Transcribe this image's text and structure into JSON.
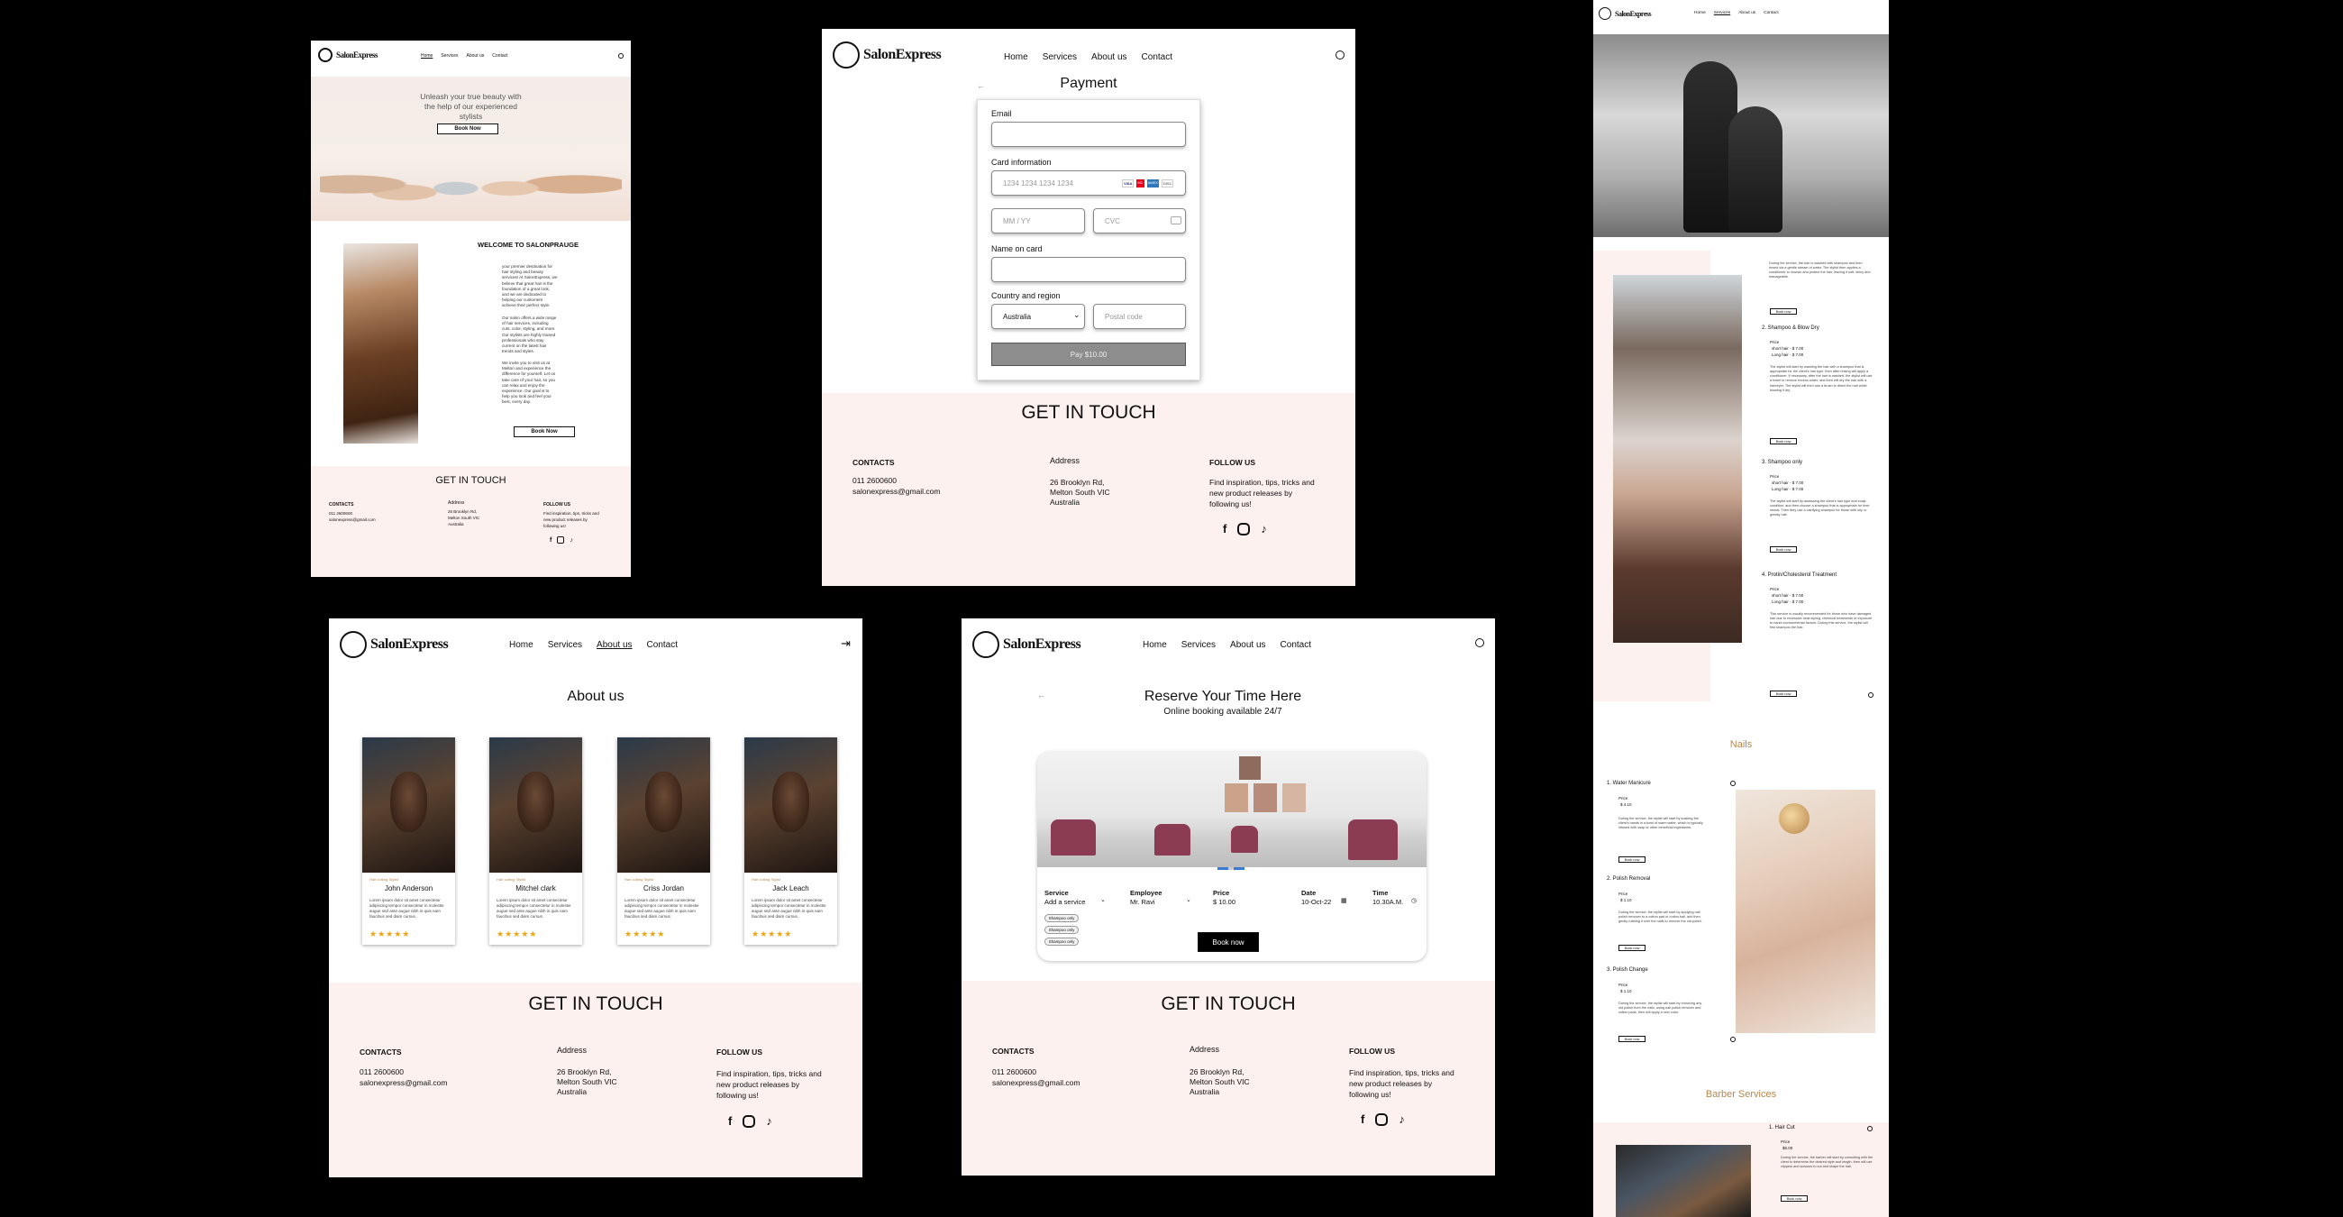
{
  "brand": {
    "name": "SalonExpress"
  },
  "nav": {
    "home": "Home",
    "services": "Services",
    "about": "About us",
    "contact": "Contact"
  },
  "footer": {
    "title": "GET IN TOUCH",
    "contacts_label": "CONTACTS",
    "phone": "011 2600600",
    "email": "salonexpress@gmail.com",
    "address_label": "Address",
    "address_1": "26 Brooklyn Rd,",
    "address_2": "Melton South VIC",
    "address_3": "Australia",
    "follow_label": "FOLLOW US",
    "follow_1": "Find inspiration, tips, tricks and",
    "follow_2": "new product releases by",
    "follow_3": "following us!",
    "facebook": "f",
    "tiktok": "♪"
  },
  "home": {
    "hero_1": "Unleash your true beauty with",
    "hero_2": "the help of our experienced",
    "hero_3": "stylists",
    "book_now": "Book Now",
    "welcome": "WELCOME TO SALONPRAUGE",
    "para1": "your premier destination for hair styling and beauty services! At SalonExpress, we believe that great hair is the foundation of a great look, and we are dedicated to helping our customers achieve their perfect style.",
    "para2": "Our salon offers a wide range of hair services, including cuts, color, styling, and more. Our stylists are highly trained professionals who stay current on the latest hair trends and styles.",
    "para3": "We invite you to visit us at Melton and experience the difference for yourself. Let us take care of your hair, so you can relax and enjoy the experience. Our goal is to help you look and feel your best, every day.",
    "book_now_2": "Book Now"
  },
  "payment": {
    "title": "Payment",
    "email_label": "Email",
    "card_label": "Card information",
    "card_placeholder": "1234 1234 1234 1234",
    "mm_placeholder": "MM / YY",
    "cvc_placeholder": "CVC",
    "name_label": "Name on card",
    "country_label": "Country and region",
    "country_value": "Australia",
    "postal_placeholder": "Postal code",
    "pay_button": "Pay $10.00",
    "card_brands": [
      "VISA",
      "MC",
      "AMEX",
      "DISC"
    ]
  },
  "about": {
    "title": "About us",
    "staff": [
      {
        "role": "Hair cutting Stylist",
        "name": "John Anderson",
        "bio": "Lorem ipsum dolor sit amet consectetur adipiscing tempor consectetur in molestie augue sed ante augue nibh in quis nam faucibus sed diam cursus.",
        "stars": "★★★★★"
      },
      {
        "role": "Hair cutting Stylist",
        "name": "Mitchel clark",
        "bio": "Lorem ipsum dolor sit amet consectetur adipiscing tempor consectetur in molestie augue sed ante augue nibh in quis nam faucibus sed diam cursus.",
        "stars": "★★★★★"
      },
      {
        "role": "Hair cutting Stylist",
        "name": "Criss Jordan",
        "bio": "Lorem ipsum dolor sit amet consectetur adipiscing tempor consectetur in molestie augue sed ante augue nibh in quis nam faucibus sed diam cursus.",
        "stars": "★★★★★"
      },
      {
        "role": "Hair cutting Stylist",
        "name": "Jack Leach",
        "bio": "Lorem ipsum dolor sit amet consectetur adipiscing tempor consectetur in molestie augue sed ante augue nibh in quis nam faucibus sed diam cursus.",
        "stars": "★★★★★"
      }
    ]
  },
  "booking": {
    "title": "Reserve Your Time Here",
    "subtitle": "Online booking available 24/7",
    "service_label": "Service",
    "service_value": "Add a service",
    "employee_label": "Employee",
    "employee_value": "Mr. Ravi",
    "price_label": "Price",
    "price_value": "$ 10.00",
    "date_label": "Date",
    "date_value": "10-Oct-22",
    "time_label": "Time",
    "time_value": "10.30A.M.",
    "chips": [
      "Shampoo only",
      "Shampoo only",
      "Shampoo only"
    ],
    "book_button": "Book now"
  },
  "services": {
    "intro": "During the service, the hair is washed with shampoo and then rinsed via a gentle stream of water. The stylist then applies a conditioner to nourish and protect the hair, leaving it soft, shiny and manageable.",
    "book_now": "Book now",
    "price_label": "Price",
    "items": [
      {
        "title": "2. Shampoo & Blow Dry",
        "short": "short hair - $ 7.00",
        "long": "Long hair - $ 7.00",
        "desc": "The stylist will start by washing the hair with a shampoo that is appropriate for the client's hair type, then after rinsing will apply a conditioner. If necessary, after the hair is washed, the stylist will use a towel to remove excess water, and then will dry the hair with a hairdryer. The stylist will then use a brush to direct the hair while blowing it dry."
      },
      {
        "title": "3. Shampoo only",
        "short": "short hair - $ 7.00",
        "long": "Long hair - $ 7.00",
        "desc": "The stylist will start by assessing the client's hair type and scalp condition, and then choose a shampoo that is appropriate for their needs. Then they use a clarifying shampoo for those with oily or greasy hair."
      },
      {
        "title": "4. Protin/Cholesterol Treatment",
        "short": "short hair - $ 7.00",
        "long": "Long hair - $ 7.00",
        "desc": "This service is usually recommended for those who have damaged hair due to excessive heat styling, chemical treatments or exposure to harsh environmental factors. During this service, the stylist will first shampoo the hair."
      }
    ],
    "nails_title": "Nails",
    "nails": [
      {
        "title": "1. Water Manicure",
        "price": "$ 4.10",
        "desc": "During the service, the stylist will start by soaking the client's hands in a bowl of warm water, which is typically infused with soap or other beneficial ingredients."
      },
      {
        "title": "2. Polish Removal",
        "price": "$ 1.10",
        "desc": "During the service, the stylist will start by applying nail polish remover to a cotton pad or cotton ball, and then gently rubbing it over the nails to remove the old polish."
      },
      {
        "title": "3. Polish Change",
        "price": "$ 1.10",
        "desc": "During the service, the stylist will start by removing any old polish from the nails, using nail polish remover and cotton pads, then will apply a new color."
      }
    ],
    "barber_title": "Barber Services",
    "barber_item": {
      "title": "1. Hair Cut",
      "price": "$5.00",
      "desc": "During the service, the barber will start by consulting with the client to determine the desired style and length, then will use clippers and scissors to cut and shape the hair."
    }
  }
}
